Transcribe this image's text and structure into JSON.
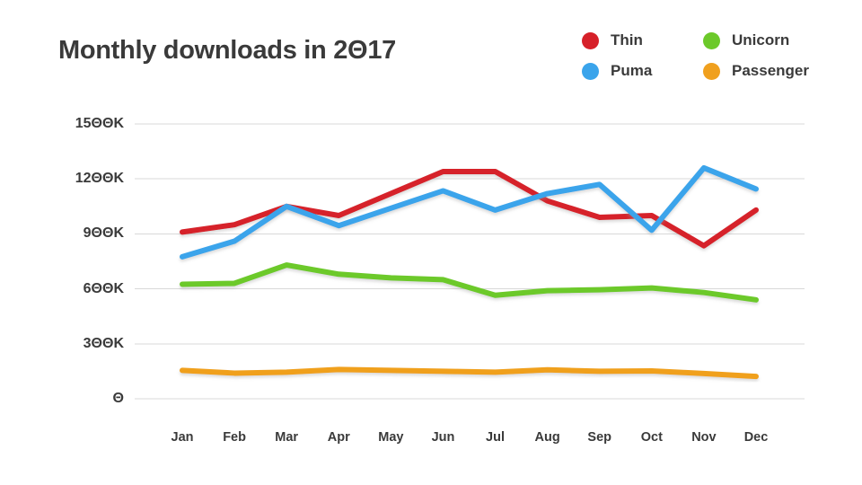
{
  "chart_data": {
    "type": "line",
    "title": "Monthly downloads in 2017",
    "xlabel": "",
    "ylabel": "",
    "categories": [
      "Jan",
      "Feb",
      "Mar",
      "Apr",
      "May",
      "Jun",
      "Jul",
      "Aug",
      "Sep",
      "Oct",
      "Nov",
      "Dec"
    ],
    "ylim": [
      0,
      1500000
    ],
    "y_ticks": [
      0,
      300000,
      600000,
      900000,
      1200000,
      1500000
    ],
    "y_tick_labels": [
      "0",
      "300K",
      "600K",
      "900K",
      "1200K",
      "1500K"
    ],
    "grid": true,
    "legend_position": "top-right",
    "series": [
      {
        "name": "Thin",
        "color": "#d62029",
        "values": [
          910000,
          950000,
          1050000,
          1000000,
          1120000,
          1240000,
          1240000,
          1080000,
          990000,
          1000000,
          835000,
          1030000
        ]
      },
      {
        "name": "Puma",
        "color": "#3aa4eb",
        "values": [
          775000,
          860000,
          1050000,
          945000,
          1040000,
          1135000,
          1030000,
          1120000,
          1170000,
          920000,
          1260000,
          1145000
        ]
      },
      {
        "name": "Unicorn",
        "color": "#6cc92a",
        "values": [
          625000,
          630000,
          730000,
          680000,
          660000,
          650000,
          565000,
          590000,
          595000,
          605000,
          580000,
          540000
        ]
      },
      {
        "name": "Passenger",
        "color": "#f0a01e",
        "values": [
          155000,
          140000,
          145000,
          160000,
          155000,
          150000,
          145000,
          158000,
          150000,
          152000,
          138000,
          122000
        ]
      }
    ]
  },
  "legend": {
    "items": [
      {
        "label": "Thin",
        "color": "#d62029"
      },
      {
        "label": "Unicorn",
        "color": "#6cc92a"
      },
      {
        "label": "Puma",
        "color": "#3aa4eb"
      },
      {
        "label": "Passenger",
        "color": "#f0a01e"
      }
    ]
  },
  "style": {
    "background": "#ffffff",
    "text_color": "#3a3a3a",
    "gridline_color": "#d8d8d8"
  }
}
